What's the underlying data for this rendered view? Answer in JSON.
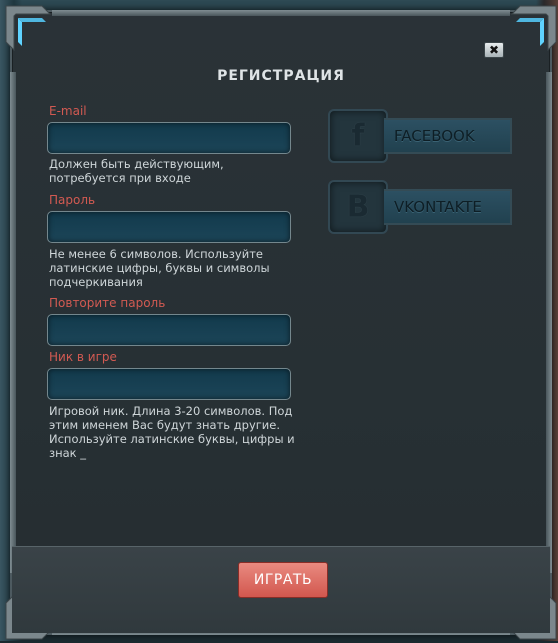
{
  "dialog": {
    "title": "РЕГИСТРАЦИЯ",
    "close_label": "✖"
  },
  "form": {
    "email": {
      "label": "E-mail",
      "value": "",
      "hint": "Должен быть действующим, потребуется при входе"
    },
    "password": {
      "label": "Пароль",
      "value": "",
      "hint": "Не менее 6 символов. Используйте латинские цифры, буквы и символы подчеркивания"
    },
    "password_repeat": {
      "label": "Повторите пароль",
      "value": ""
    },
    "nickname": {
      "label": "Ник в игре",
      "value": "",
      "hint": "Игровой ник. Длина 3-20 символов. Под этим именем Вас будут знать другие. Используйте латинские буквы, цифры и знак _"
    }
  },
  "social": {
    "facebook": {
      "icon": "f",
      "label": "FACEBOOK"
    },
    "vkontakte": {
      "icon": "B",
      "label": "VKONTAKTE"
    }
  },
  "footer": {
    "play_label": "ИГРАТЬ"
  },
  "colors": {
    "accent": "#d25a52",
    "field_bg": "#123a4c",
    "dialog_bg": "#2a3237"
  }
}
